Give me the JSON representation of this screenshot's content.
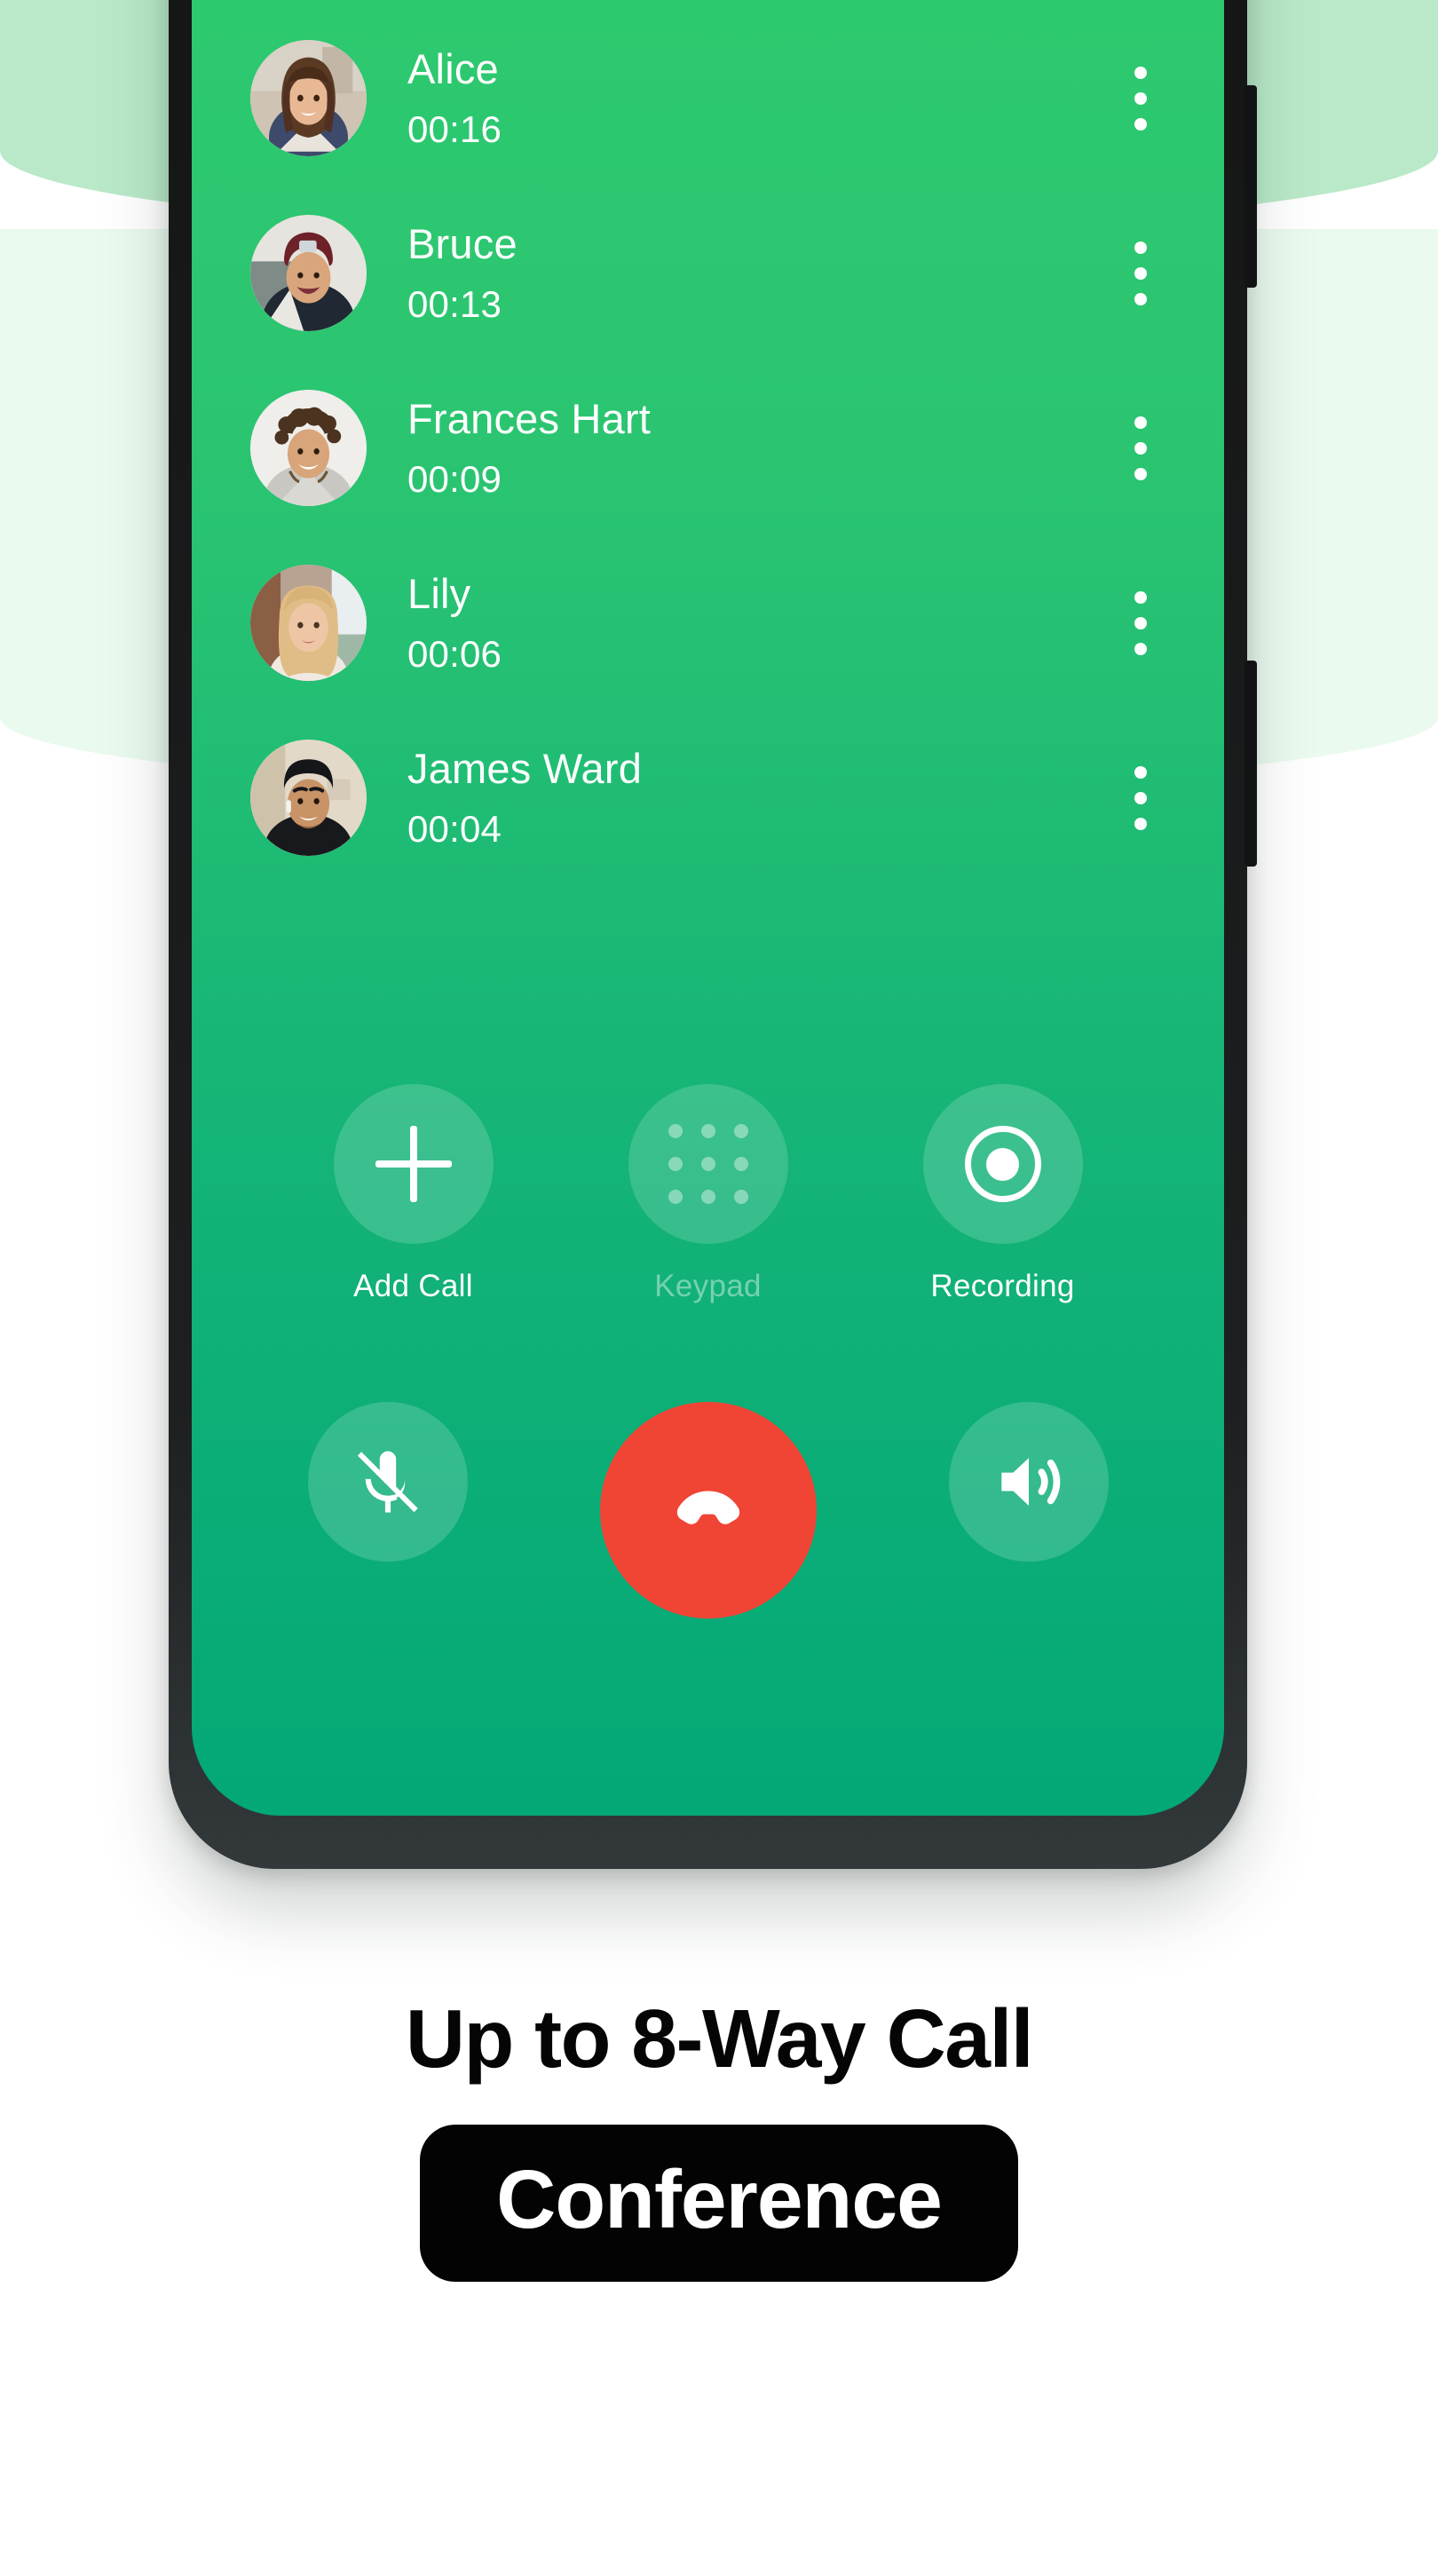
{
  "screen": {
    "app_context": "conference-call",
    "accent_green": "#2ECB6E",
    "accent_green_dark": "#03A877",
    "end_call_red": "#F04435",
    "band_mint": "#B9E9C8",
    "band_pale": "#EAFAEF"
  },
  "participants": [
    {
      "name": "Alice",
      "duration": "00:16",
      "menu_icon": "kebab-menu-icon"
    },
    {
      "name": "Bruce",
      "duration": "00:13",
      "menu_icon": "kebab-menu-icon"
    },
    {
      "name": "Frances Hart",
      "duration": "00:09",
      "menu_icon": "kebab-menu-icon"
    },
    {
      "name": "Lily",
      "duration": "00:06",
      "menu_icon": "kebab-menu-icon"
    },
    {
      "name": "James Ward",
      "duration": "00:04",
      "menu_icon": "kebab-menu-icon"
    }
  ],
  "controls": {
    "secondary": [
      {
        "label": "Add Call",
        "icon": "plus-icon",
        "enabled": true
      },
      {
        "label": "Keypad",
        "icon": "keypad-icon",
        "enabled": false
      },
      {
        "label": "Recording",
        "icon": "record-icon",
        "enabled": true
      }
    ],
    "primary": [
      {
        "label": "Mute",
        "icon": "microphone-off-icon"
      },
      {
        "label": "End Call",
        "icon": "end-call-icon"
      },
      {
        "label": "Speaker",
        "icon": "speaker-icon"
      }
    ]
  },
  "footer": {
    "headline": "Up to 8-Way Call",
    "pill_label": "Conference"
  }
}
